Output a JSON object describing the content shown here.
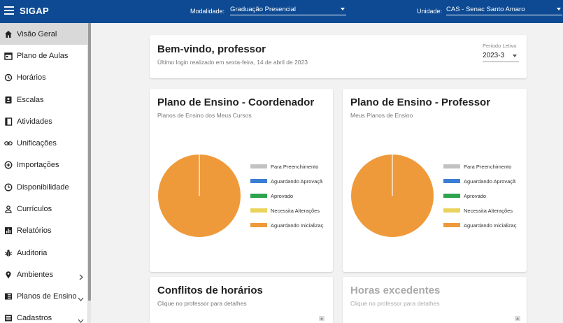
{
  "app": {
    "title": "SIGAP"
  },
  "topbar": {
    "modalidade_label": "Modalidade:",
    "modalidade_value": "Graduação Presencial",
    "unidade_label": "Unidade:",
    "unidade_value": "CAS - Senac Santo Amaro"
  },
  "sidebar": {
    "items": [
      {
        "label": "Visão Geral",
        "icon": "home-icon",
        "active": true
      },
      {
        "label": "Plano de Aulas",
        "icon": "calendar-icon"
      },
      {
        "label": "Horários",
        "icon": "history-icon"
      },
      {
        "label": "Escalas",
        "icon": "contact-card-icon"
      },
      {
        "label": "Atividades",
        "icon": "book-icon"
      },
      {
        "label": "Unificações",
        "icon": "link-icon"
      },
      {
        "label": "Importações",
        "icon": "plus-circle-icon"
      },
      {
        "label": "Disponibilidade",
        "icon": "clock-icon"
      },
      {
        "label": "Currículos",
        "icon": "person-icon"
      },
      {
        "label": "Relatórios",
        "icon": "bar-chart-icon"
      },
      {
        "label": "Auditoria",
        "icon": "bug-icon"
      },
      {
        "label": "Ambientes",
        "icon": "location-pin-icon",
        "chevron": "right"
      },
      {
        "label": "Planos de Ensino",
        "icon": "book-open-icon",
        "chevron": "down"
      },
      {
        "label": "Cadastros",
        "icon": "list-icon",
        "chevron": "down"
      }
    ]
  },
  "welcome": {
    "title": "Bem-vindo, professor",
    "subtitle": "Último login realizado em sexta-feira, 14 de abril de 2023",
    "periodo_label": "Período Letivo",
    "periodo_value": "2023-3"
  },
  "cards": {
    "coordenador": {
      "title": "Plano de Ensino - Coordenador",
      "subtitle": "Planos de Ensino dos Meus Cursos"
    },
    "professor": {
      "title": "Plano de Ensino - Professor",
      "subtitle": "Meus Planos de Ensino"
    },
    "conflitos": {
      "title": "Conflitos de horários",
      "subtitle": "Clique no professor para detalhes"
    },
    "horas": {
      "title": "Horas excedentes",
      "subtitle": "Clique no professor para detalhes"
    }
  },
  "chart_data": [
    {
      "type": "pie",
      "categories": [
        "Para Preenchimento",
        "Aguardando Aprovação",
        "Aprovado",
        "Necessita Alterações",
        "Aguardando Inicialização"
      ],
      "values": [
        0,
        0,
        0,
        0,
        1
      ],
      "colors": [
        "#c2c2c2",
        "#3b7fd4",
        "#2ea44f",
        "#ead35c",
        "#ef9a3a"
      ],
      "legend_labels": [
        "Para Preenchimento",
        "Aguardando Aprovaçã",
        "Aprovado",
        "Necessita Alterações",
        "Aguardando Inicializaç"
      ],
      "legend_position": "right"
    },
    {
      "type": "pie",
      "categories": [
        "Para Preenchimento",
        "Aguardando Aprovação",
        "Aprovado",
        "Necessita Alterações",
        "Aguardando Inicialização"
      ],
      "values": [
        0,
        0,
        0,
        0,
        1
      ],
      "colors": [
        "#c2c2c2",
        "#3b7fd4",
        "#2ea44f",
        "#ead35c",
        "#ef9a3a"
      ],
      "legend_labels": [
        "Para Preenchimento",
        "Aguardando Aprovaçã",
        "Aprovado",
        "Necessita Alterações",
        "Aguardando Inicializaç"
      ],
      "legend_position": "right"
    }
  ]
}
